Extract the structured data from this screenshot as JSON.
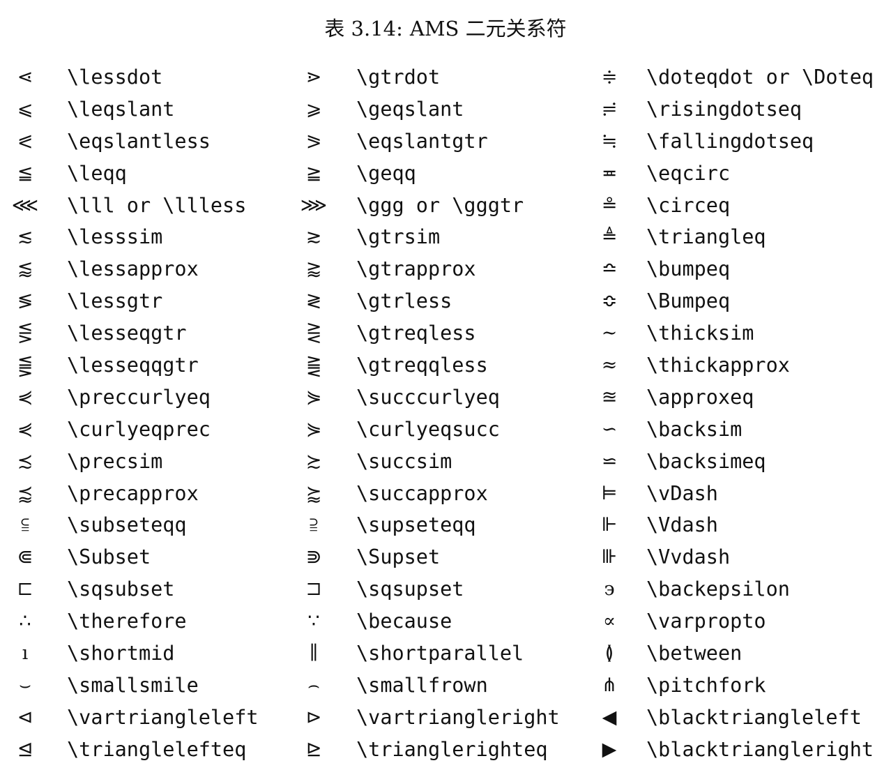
{
  "caption": {
    "number": "表 3.14:",
    "title": "AMS 二元关系符"
  },
  "rows": [
    [
      {
        "sym": "⋖",
        "cmd": "\\lessdot"
      },
      {
        "sym": "⋗",
        "cmd": "\\gtrdot"
      },
      {
        "sym": "≑",
        "cmd": "\\doteqdot or \\Doteq"
      }
    ],
    [
      {
        "sym": "⩽",
        "cmd": "\\leqslant"
      },
      {
        "sym": "⩾",
        "cmd": "\\geqslant"
      },
      {
        "sym": "≓",
        "cmd": "\\risingdotseq"
      }
    ],
    [
      {
        "sym": "⪕",
        "cmd": "\\eqslantless"
      },
      {
        "sym": "⪖",
        "cmd": "\\eqslantgtr"
      },
      {
        "sym": "≒",
        "cmd": "\\fallingdotseq"
      }
    ],
    [
      {
        "sym": "≦",
        "cmd": "\\leqq"
      },
      {
        "sym": "≧",
        "cmd": "\\geqq"
      },
      {
        "sym": "≖",
        "cmd": "\\eqcirc"
      }
    ],
    [
      {
        "sym": "⋘",
        "cmd": "\\lll or \\llless"
      },
      {
        "sym": "⋙",
        "cmd": "\\ggg or \\gggtr"
      },
      {
        "sym": "≗",
        "cmd": "\\circeq"
      }
    ],
    [
      {
        "sym": "≲",
        "cmd": "\\lesssim"
      },
      {
        "sym": "≳",
        "cmd": "\\gtrsim"
      },
      {
        "sym": "≜",
        "cmd": "\\triangleq"
      }
    ],
    [
      {
        "sym": "⪅",
        "cmd": "\\lessapprox"
      },
      {
        "sym": "⪆",
        "cmd": "\\gtrapprox"
      },
      {
        "sym": "≏",
        "cmd": "\\bumpeq"
      }
    ],
    [
      {
        "sym": "≶",
        "cmd": "\\lessgtr"
      },
      {
        "sym": "≷",
        "cmd": "\\gtrless"
      },
      {
        "sym": "≎",
        "cmd": "\\Bumpeq"
      }
    ],
    [
      {
        "sym": "⋚",
        "cmd": "\\lesseqgtr"
      },
      {
        "sym": "⋛",
        "cmd": "\\gtreqless"
      },
      {
        "sym": "∼",
        "cmd": "\\thicksim"
      }
    ],
    [
      {
        "sym": "⪋",
        "cmd": "\\lesseqqgtr"
      },
      {
        "sym": "⪌",
        "cmd": "\\gtreqqless"
      },
      {
        "sym": "≈",
        "cmd": "\\thickapprox"
      }
    ],
    [
      {
        "sym": "⋞",
        "cmd": "\\preccurlyeq"
      },
      {
        "sym": "⋟",
        "cmd": "\\succcurlyeq"
      },
      {
        "sym": "≊",
        "cmd": "\\approxeq"
      }
    ],
    [
      {
        "sym": "⋞",
        "cmd": "\\curlyeqprec"
      },
      {
        "sym": "⋟",
        "cmd": "\\curlyeqsucc"
      },
      {
        "sym": "∽",
        "cmd": "\\backsim"
      }
    ],
    [
      {
        "sym": "≾",
        "cmd": "\\precsim"
      },
      {
        "sym": "≿",
        "cmd": "\\succsim"
      },
      {
        "sym": "⋍",
        "cmd": "\\backsimeq"
      }
    ],
    [
      {
        "sym": "⪷",
        "cmd": "\\precapprox"
      },
      {
        "sym": "⪸",
        "cmd": "\\succapprox"
      },
      {
        "sym": "⊨",
        "cmd": "\\vDash"
      }
    ],
    [
      {
        "sym": "⫅",
        "cmd": "\\subseteqq"
      },
      {
        "sym": "⫆",
        "cmd": "\\supseteqq"
      },
      {
        "sym": "⊩",
        "cmd": "\\Vdash"
      }
    ],
    [
      {
        "sym": "⋐",
        "cmd": "\\Subset"
      },
      {
        "sym": "⋑",
        "cmd": "\\Supset"
      },
      {
        "sym": "⊪",
        "cmd": "\\Vvdash"
      }
    ],
    [
      {
        "sym": "⊏",
        "cmd": "\\sqsubset"
      },
      {
        "sym": "⊐",
        "cmd": "\\sqsupset"
      },
      {
        "sym": "϶",
        "cmd": "\\backepsilon"
      }
    ],
    [
      {
        "sym": "∴",
        "cmd": "\\therefore"
      },
      {
        "sym": "∵",
        "cmd": "\\because"
      },
      {
        "sym": "∝",
        "cmd": "\\varpropto"
      }
    ],
    [
      {
        "sym": "ı",
        "cmd": "\\shortmid"
      },
      {
        "sym": "∥",
        "cmd": "\\shortparallel"
      },
      {
        "sym": "≬",
        "cmd": "\\between"
      }
    ],
    [
      {
        "sym": "⌣",
        "cmd": "\\smallsmile"
      },
      {
        "sym": "⌢",
        "cmd": "\\smallfrown"
      },
      {
        "sym": "⋔",
        "cmd": "\\pitchfork"
      }
    ],
    [
      {
        "sym": "⊲",
        "cmd": "\\vartriangleleft"
      },
      {
        "sym": "⊳",
        "cmd": "\\vartriangleright"
      },
      {
        "sym": "◀",
        "cmd": "\\blacktriangleleft"
      }
    ],
    [
      {
        "sym": "⊴",
        "cmd": "\\trianglelefteq"
      },
      {
        "sym": "⊵",
        "cmd": "\\trianglerighteq"
      },
      {
        "sym": "▶",
        "cmd": "\\blacktriangleright"
      }
    ]
  ]
}
